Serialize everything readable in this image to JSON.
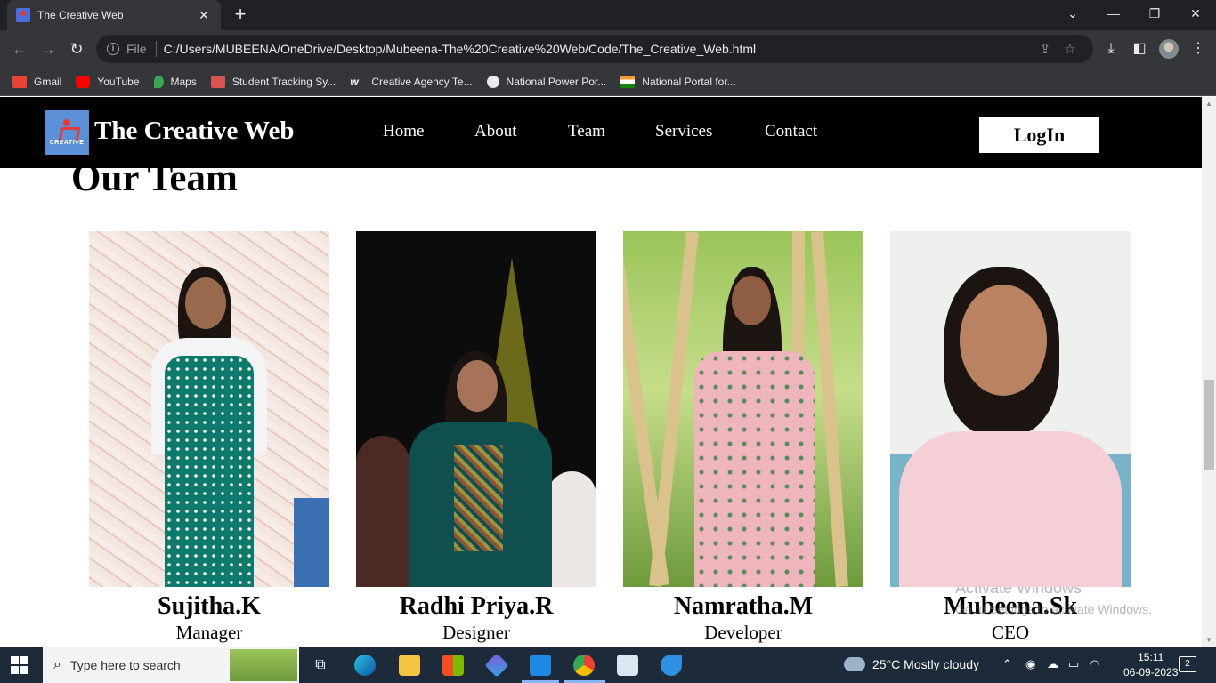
{
  "browser": {
    "tab_title": "The Creative Web",
    "tab_close": "✕",
    "new_tab": "+",
    "scheme_label": "File",
    "url": "C:/Users/MUBEENA/OneDrive/Desktop/Mubeena-The%20Creative%20Web/Code/The_Creative_Web.html",
    "window_controls": [
      "⌄",
      "—",
      "❐",
      "✕"
    ],
    "bookmarks": [
      {
        "label": "Gmail",
        "icon": "gmail-icon",
        "color": "#ea4335"
      },
      {
        "label": "YouTube",
        "icon": "youtube-icon",
        "color": "#ff0000"
      },
      {
        "label": "Maps",
        "icon": "maps-icon",
        "color": "#34a853"
      },
      {
        "label": "Student Tracking Sy...",
        "icon": "student-tracking-icon",
        "color": "#d9534f"
      },
      {
        "label": "Creative Agency Te...",
        "icon": "creative-agency-icon",
        "color": "#ffffff"
      },
      {
        "label": "National Power Por...",
        "icon": "globe-icon",
        "color": "#e8eaed"
      },
      {
        "label": "National Portal for...",
        "icon": "india-flag-icon",
        "color": "#ff9933"
      }
    ]
  },
  "site": {
    "brand": "The Creative Web",
    "logo_text": "CREATIVE",
    "nav": [
      "Home",
      "About",
      "Team",
      "Services",
      "Contact"
    ],
    "login_label": "LogIn",
    "section_title": "Our Team",
    "team": [
      {
        "name": "Sujitha.K",
        "role": "Manager"
      },
      {
        "name": "Radhi Priya.R",
        "role": "Designer"
      },
      {
        "name": "Namratha.M",
        "role": "Developer"
      },
      {
        "name": "Mubeena.Sk",
        "role": "CEO"
      }
    ]
  },
  "watermark": {
    "line1": "Activate Windows",
    "line2": "Go to Settings to activate Windows."
  },
  "taskbar": {
    "search_placeholder": "Type here to search",
    "weather": "25°C  Mostly cloudy",
    "time": "15:11",
    "date": "06-09-2023",
    "notifications": "2"
  }
}
